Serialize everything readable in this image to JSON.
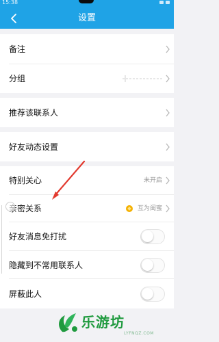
{
  "status_bar": {
    "time": "15:38"
  },
  "header": {
    "title": "设置"
  },
  "rows": {
    "remark": {
      "label": "备注"
    },
    "group": {
      "label": "分组"
    },
    "recommend": {
      "label": "推荐该联系人"
    },
    "moments": {
      "label": "好友动态设置"
    },
    "special_care": {
      "label": "特别关心",
      "value": "未开启"
    },
    "intimate": {
      "label": "亲密关系",
      "value": "互为闺蜜"
    },
    "mute": {
      "label": "好友消息免打扰",
      "toggle": "off"
    },
    "hide": {
      "label": "隐藏到不常用联系人",
      "toggle": "off"
    },
    "block": {
      "label": "屏蔽此人",
      "toggle": "off"
    }
  },
  "watermark": {
    "brand": "乐游坊",
    "url": "LYFNQZ.COM"
  },
  "colors": {
    "header": "#1fa3e6",
    "arrow": "#e23a2f",
    "watermark": "#1f9a3e"
  },
  "icons": [
    "back-arrow-icon",
    "chevron-right-icon",
    "friendship-badge-icon",
    "annotation-arrow-icon"
  ]
}
